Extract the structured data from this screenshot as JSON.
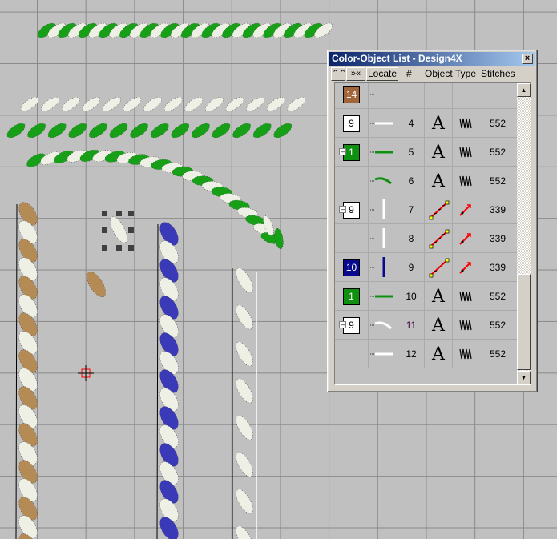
{
  "window": {
    "title": "Color-Object List - Design4X",
    "close_label": "×"
  },
  "toolbar": {
    "collapse_label": "⌃⌃",
    "expand_label": "»«",
    "locate_label": "Locate"
  },
  "columns": {
    "num": "#",
    "object": "Object",
    "type": "Type",
    "stitches": "Stitches"
  },
  "rows": [
    {
      "color": "14",
      "swatch": "#a0663a",
      "text": "#fff",
      "num": "",
      "object": "",
      "type": "",
      "stitches": "",
      "preview": "none"
    },
    {
      "color": "9",
      "swatch": "#ffffff",
      "text": "#000",
      "num": "4",
      "object": "A",
      "type": "satin",
      "stitches": "552",
      "preview": "h-white"
    },
    {
      "color": "1",
      "swatch": "#109010",
      "text": "#fff",
      "num": "5",
      "object": "A",
      "type": "satin",
      "stitches": "552",
      "preview": "h-green",
      "collapse": true
    },
    {
      "color": "",
      "num": "6",
      "object": "A",
      "type": "satin",
      "stitches": "552",
      "preview": "curve-green",
      "child": true
    },
    {
      "color": "9",
      "swatch": "#ffffff",
      "text": "#000",
      "num": "7",
      "object": "run",
      "type": "run",
      "stitches": "339",
      "preview": "v-white",
      "collapse": true
    },
    {
      "color": "",
      "num": "8",
      "object": "run",
      "type": "run",
      "stitches": "339",
      "preview": "v-white",
      "child": true
    },
    {
      "color": "10",
      "swatch": "#0a0a90",
      "text": "#fff",
      "num": "9",
      "object": "run",
      "type": "run",
      "stitches": "339",
      "preview": "v-blue"
    },
    {
      "color": "1",
      "swatch": "#109010",
      "text": "#fff",
      "num": "10",
      "object": "A",
      "type": "satin",
      "stitches": "552",
      "preview": "h-green"
    },
    {
      "color": "9",
      "swatch": "#ffffff",
      "text": "#000",
      "num": "11",
      "object": "A",
      "type": "satin",
      "stitches": "552",
      "preview": "curve-white",
      "collapse": true,
      "numcolor": "#400040"
    },
    {
      "color": "",
      "num": "12",
      "object": "A",
      "type": "satin",
      "stitches": "552",
      "preview": "h-white",
      "child": true
    }
  ],
  "colors": {
    "green": "#17a017",
    "white": "#eef0e6",
    "brown": "#b48a55",
    "blue": "#3a3ab8"
  }
}
